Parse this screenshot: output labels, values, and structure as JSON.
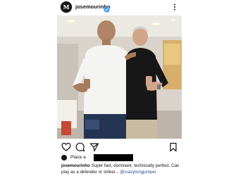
{
  "post": {
    "username": "josemourinho",
    "verified": true,
    "accent_verified": "#3897f0",
    "likes": {
      "prefix": "Place a"
    },
    "caption": {
      "user": "josemourinho",
      "text": " Super fast, dominant, technically perfect. Can play as a defender or striker... ",
      "tag": "@crazylongjumper"
    }
  },
  "icons": {
    "header": [
      "avatar",
      "verified-badge-icon",
      "more-options-icon"
    ],
    "actions": [
      "heart-icon",
      "comment-icon",
      "share-icon",
      "bookmark-icon"
    ]
  },
  "colors": {
    "text": "#111111",
    "link": "#2b4a8a",
    "background": "#ffffff"
  }
}
